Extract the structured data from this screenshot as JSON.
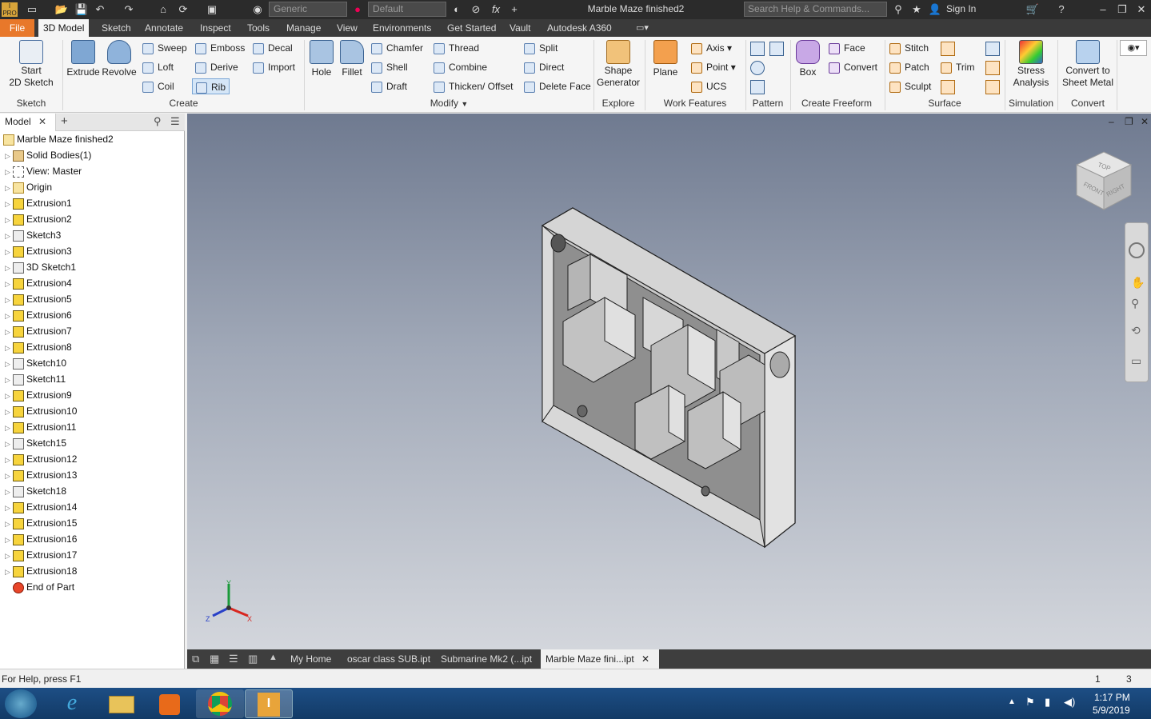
{
  "titlebar": {
    "title": "Marble Maze finished2",
    "material": "Generic",
    "appearance": "Default",
    "search_placeholder": "Search Help & Commands...",
    "sign_in": "Sign In",
    "fx": "fx"
  },
  "ribbon_tabs": [
    "File",
    "3D Model",
    "Sketch",
    "Annotate",
    "Inspect",
    "Tools",
    "Manage",
    "View",
    "Environments",
    "Get Started",
    "Vault",
    "Autodesk A360"
  ],
  "ribbon": {
    "start_sketch_label_1": "Start",
    "start_sketch_label_2": "2D Sketch",
    "sketch_group": "Sketch",
    "extrude": "Extrude",
    "revolve": "Revolve",
    "sweep": "Sweep",
    "loft": "Loft",
    "coil": "Coil",
    "emboss": "Emboss",
    "derive": "Derive",
    "rib": "Rib",
    "decal": "Decal",
    "import": "Import",
    "create_group": "Create",
    "hole": "Hole",
    "fillet": "Fillet",
    "chamfer": "Chamfer",
    "shell": "Shell",
    "draft": "Draft",
    "thread": "Thread",
    "combine": "Combine",
    "thicken_offset": "Thicken/ Offset",
    "split": "Split",
    "direct": "Direct",
    "delete_face": "Delete Face",
    "modify_group": "Modify",
    "shape_generator_1": "Shape",
    "shape_generator_2": "Generator",
    "explore_group": "Explore",
    "plane": "Plane",
    "axis": "Axis",
    "point": "Point",
    "ucs": "UCS",
    "work_features_group": "Work Features",
    "pattern_group": "Pattern",
    "box": "Box",
    "face": "Face",
    "convert": "Convert",
    "create_freeform_group": "Create Freeform",
    "stitch": "Stitch",
    "patch": "Patch",
    "sculpt": "Sculpt",
    "trim": "Trim",
    "surface_group": "Surface",
    "stress_1": "Stress",
    "stress_2": "Analysis",
    "simulation_group": "Simulation",
    "convert_to_1": "Convert to",
    "convert_to_2": "Sheet Metal",
    "convert_group": "Convert"
  },
  "browser": {
    "tab": "Model",
    "items": [
      {
        "label": "Marble Maze finished2",
        "type": "part"
      },
      {
        "label": "Solid Bodies(1)",
        "type": "body"
      },
      {
        "label": "View: Master",
        "type": "view"
      },
      {
        "label": "Origin",
        "type": "fold"
      },
      {
        "label": "Extrusion1",
        "type": "ext"
      },
      {
        "label": "Extrusion2",
        "type": "ext"
      },
      {
        "label": "Sketch3",
        "type": "sk"
      },
      {
        "label": "Extrusion3",
        "type": "ext"
      },
      {
        "label": "3D Sketch1",
        "type": "sk"
      },
      {
        "label": "Extrusion4",
        "type": "ext"
      },
      {
        "label": "Extrusion5",
        "type": "ext"
      },
      {
        "label": "Extrusion6",
        "type": "ext"
      },
      {
        "label": "Extrusion7",
        "type": "ext"
      },
      {
        "label": "Extrusion8",
        "type": "ext"
      },
      {
        "label": "Sketch10",
        "type": "sk"
      },
      {
        "label": "Sketch11",
        "type": "sk"
      },
      {
        "label": "Extrusion9",
        "type": "ext"
      },
      {
        "label": "Extrusion10",
        "type": "ext"
      },
      {
        "label": "Extrusion11",
        "type": "ext"
      },
      {
        "label": "Sketch15",
        "type": "sk"
      },
      {
        "label": "Extrusion12",
        "type": "ext"
      },
      {
        "label": "Extrusion13",
        "type": "ext"
      },
      {
        "label": "Sketch18",
        "type": "sk"
      },
      {
        "label": "Extrusion14",
        "type": "ext"
      },
      {
        "label": "Extrusion15",
        "type": "ext"
      },
      {
        "label": "Extrusion16",
        "type": "ext"
      },
      {
        "label": "Extrusion17",
        "type": "ext"
      },
      {
        "label": "Extrusion18",
        "type": "ext"
      },
      {
        "label": "End of Part",
        "type": "end"
      }
    ]
  },
  "viewcube": {
    "top": "TOP",
    "front": "FRONT",
    "right": "RIGHT"
  },
  "triad": {
    "x": "X",
    "y": "Y",
    "z": "Z"
  },
  "doc_tabs": [
    "My Home",
    "oscar class SUB.ipt",
    "Submarine Mk2 (...ipt",
    "Marble Maze fini...ipt"
  ],
  "status": {
    "help": "For Help, press F1",
    "count1": "1",
    "count2": "3"
  },
  "taskbar": {
    "time": "1:17 PM",
    "date": "5/9/2019"
  }
}
